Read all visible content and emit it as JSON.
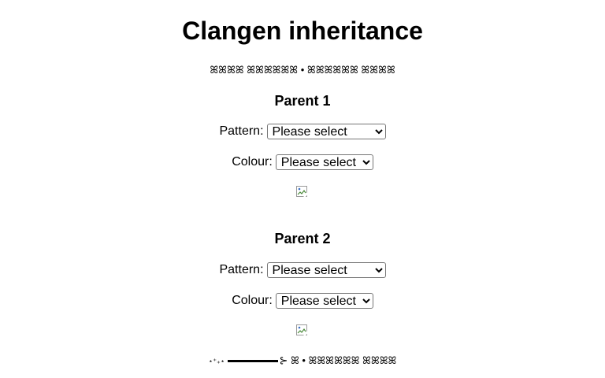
{
  "page": {
    "title": "Clangen inheritance",
    "top_divider": "ꕤꕤꕤꕤ ꕤꕤꕤꕤꕤꕤ • ꕤꕤꕤꕤꕤꕤ ꕤꕤꕤꕤ"
  },
  "parents": [
    {
      "heading": "Parent 1",
      "pattern_label": "Pattern:",
      "pattern_value": "Please select",
      "colour_label": "Colour:",
      "colour_value": "Please select"
    },
    {
      "heading": "Parent 2",
      "pattern_label": "Pattern:",
      "pattern_value": "Please select",
      "colour_label": "Colour:",
      "colour_value": "Please select"
    }
  ],
  "bottom_divider": {
    "stars": "⋆⁺₊⋆",
    "tail": "⊱ ꕤ • ꕤꕤꕤꕤꕤꕤ ꕤꕤꕤꕤ"
  },
  "icons": {
    "broken_image": "broken-image-icon"
  }
}
